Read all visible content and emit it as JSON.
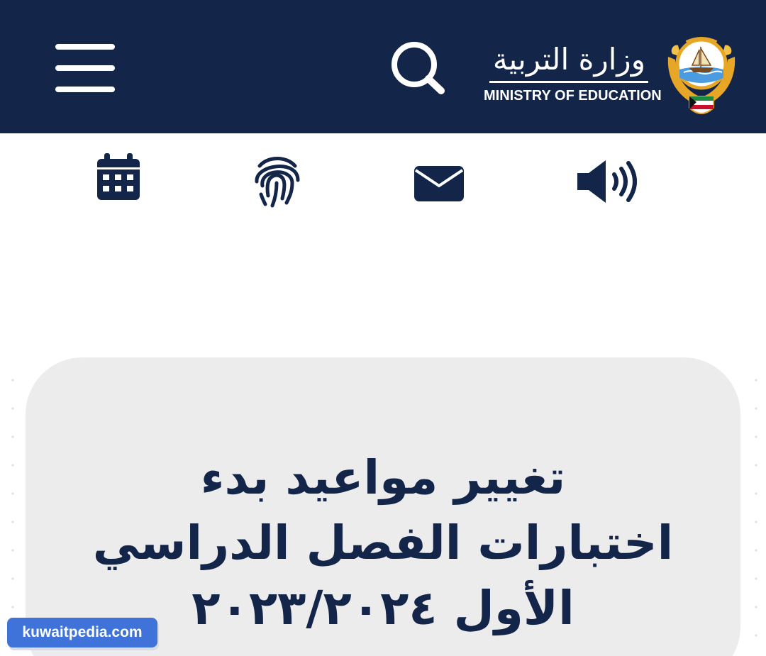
{
  "header": {
    "brand_arabic": "وزارة التربية",
    "brand_english": "MINISTRY OF EDUCATION",
    "background_color": "#14254a"
  },
  "toolbar": {
    "icons": [
      "calendar-icon",
      "fingerprint-icon",
      "mail-icon",
      "speaker-icon"
    ],
    "icon_color": "#14254a"
  },
  "article": {
    "headline_lines": [
      "تغيير مواعيد بدء",
      "اختبارات الفصل الدراسي",
      "الأول ٢٠٢٣/٢٠٢٤"
    ],
    "card_color": "#ececec"
  },
  "watermark": {
    "text": "kuwaitpedia.com",
    "color": "#3f73d9"
  }
}
